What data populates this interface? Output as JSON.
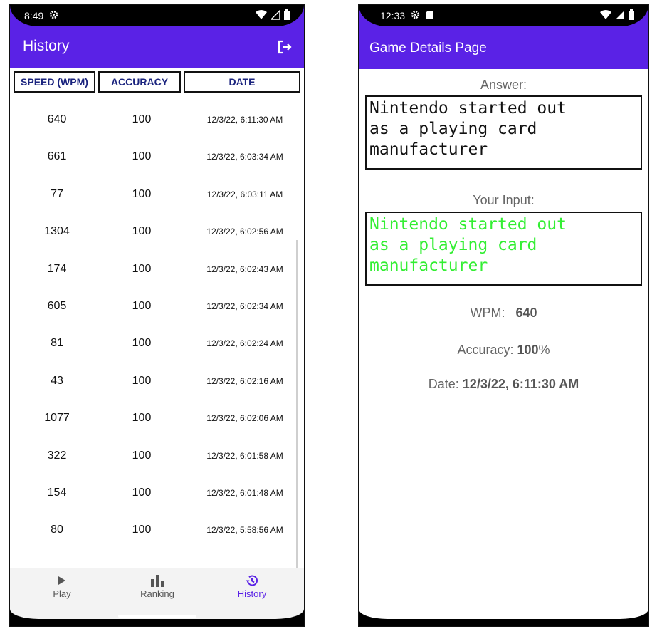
{
  "left_phone": {
    "status_time": "8:49",
    "title": "History",
    "columns": [
      "SPEED (WPM)",
      "ACCURACY",
      "DATE"
    ],
    "rows": [
      {
        "speed": "640",
        "accuracy": "100",
        "date": "12/3/22, 6:11:30 AM"
      },
      {
        "speed": "661",
        "accuracy": "100",
        "date": "12/3/22, 6:03:34 AM"
      },
      {
        "speed": "77",
        "accuracy": "100",
        "date": "12/3/22, 6:03:11 AM"
      },
      {
        "speed": "1304",
        "accuracy": "100",
        "date": "12/3/22, 6:02:56 AM"
      },
      {
        "speed": "174",
        "accuracy": "100",
        "date": "12/3/22, 6:02:43 AM"
      },
      {
        "speed": "605",
        "accuracy": "100",
        "date": "12/3/22, 6:02:34 AM"
      },
      {
        "speed": "81",
        "accuracy": "100",
        "date": "12/3/22, 6:02:24 AM"
      },
      {
        "speed": "43",
        "accuracy": "100",
        "date": "12/3/22, 6:02:16 AM"
      },
      {
        "speed": "1077",
        "accuracy": "100",
        "date": "12/3/22, 6:02:06 AM"
      },
      {
        "speed": "322",
        "accuracy": "100",
        "date": "12/3/22, 6:01:58 AM"
      },
      {
        "speed": "154",
        "accuracy": "100",
        "date": "12/3/22, 6:01:48 AM"
      },
      {
        "speed": "80",
        "accuracy": "100",
        "date": "12/3/22, 5:58:56 AM"
      }
    ],
    "nav": {
      "play": "Play",
      "ranking": "Ranking",
      "history": "History"
    }
  },
  "right_phone": {
    "status_time": "12:33",
    "title": "Game Details Page",
    "answer_label": "Answer:",
    "answer_lines": [
      "Nintendo started out",
      "as a playing card",
      "manufacturer"
    ],
    "input_label": "Your Input:",
    "input_lines": [
      "Nintendo started out",
      "as a playing card",
      "manufacturer"
    ],
    "wpm_label": "WPM:",
    "wpm_value": "640",
    "accuracy_label": "Accuracy:",
    "accuracy_value": "100",
    "accuracy_suffix": "%",
    "date_label": "Date:",
    "date_value": "12/3/22, 6:11:30 AM"
  },
  "colors": {
    "appbar": "#5a22e6",
    "input_text": "#33ee33",
    "header_text": "#1a237e"
  }
}
